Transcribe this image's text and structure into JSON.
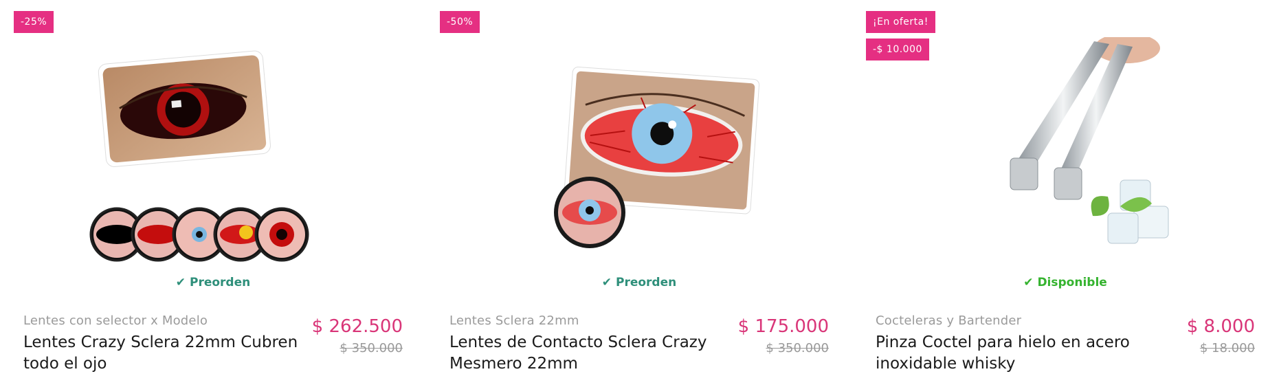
{
  "products": [
    {
      "badges": [
        "-25%"
      ],
      "stock": "Preorden",
      "category": "Lentes con selector x Modelo",
      "title": "Lentes Crazy Sclera 22mm Cubren todo el ojo",
      "price": "$ 262.500",
      "old_price": "$ 350.000"
    },
    {
      "badges": [
        "-50%"
      ],
      "stock": "Preorden",
      "category": "Lentes Sclera 22mm",
      "title": "Lentes de Contacto Sclera Crazy Mesmero 22mm",
      "price": "$ 175.000",
      "old_price": "$ 350.000"
    },
    {
      "badges": [
        "¡En oferta!",
        "-$ 10.000"
      ],
      "stock": "Disponible",
      "category": "Cocteleras y Bartender",
      "title": "Pinza Coctel para hielo en acero inoxidable whisky",
      "price": "$ 8.000",
      "old_price": "$ 18.000"
    }
  ],
  "colors": {
    "badge": "#e52f82",
    "price": "#d93578",
    "preorder": "#2e8f7a",
    "available": "#35b32f"
  },
  "icons": {
    "stock_check": "checkmark-icon"
  }
}
